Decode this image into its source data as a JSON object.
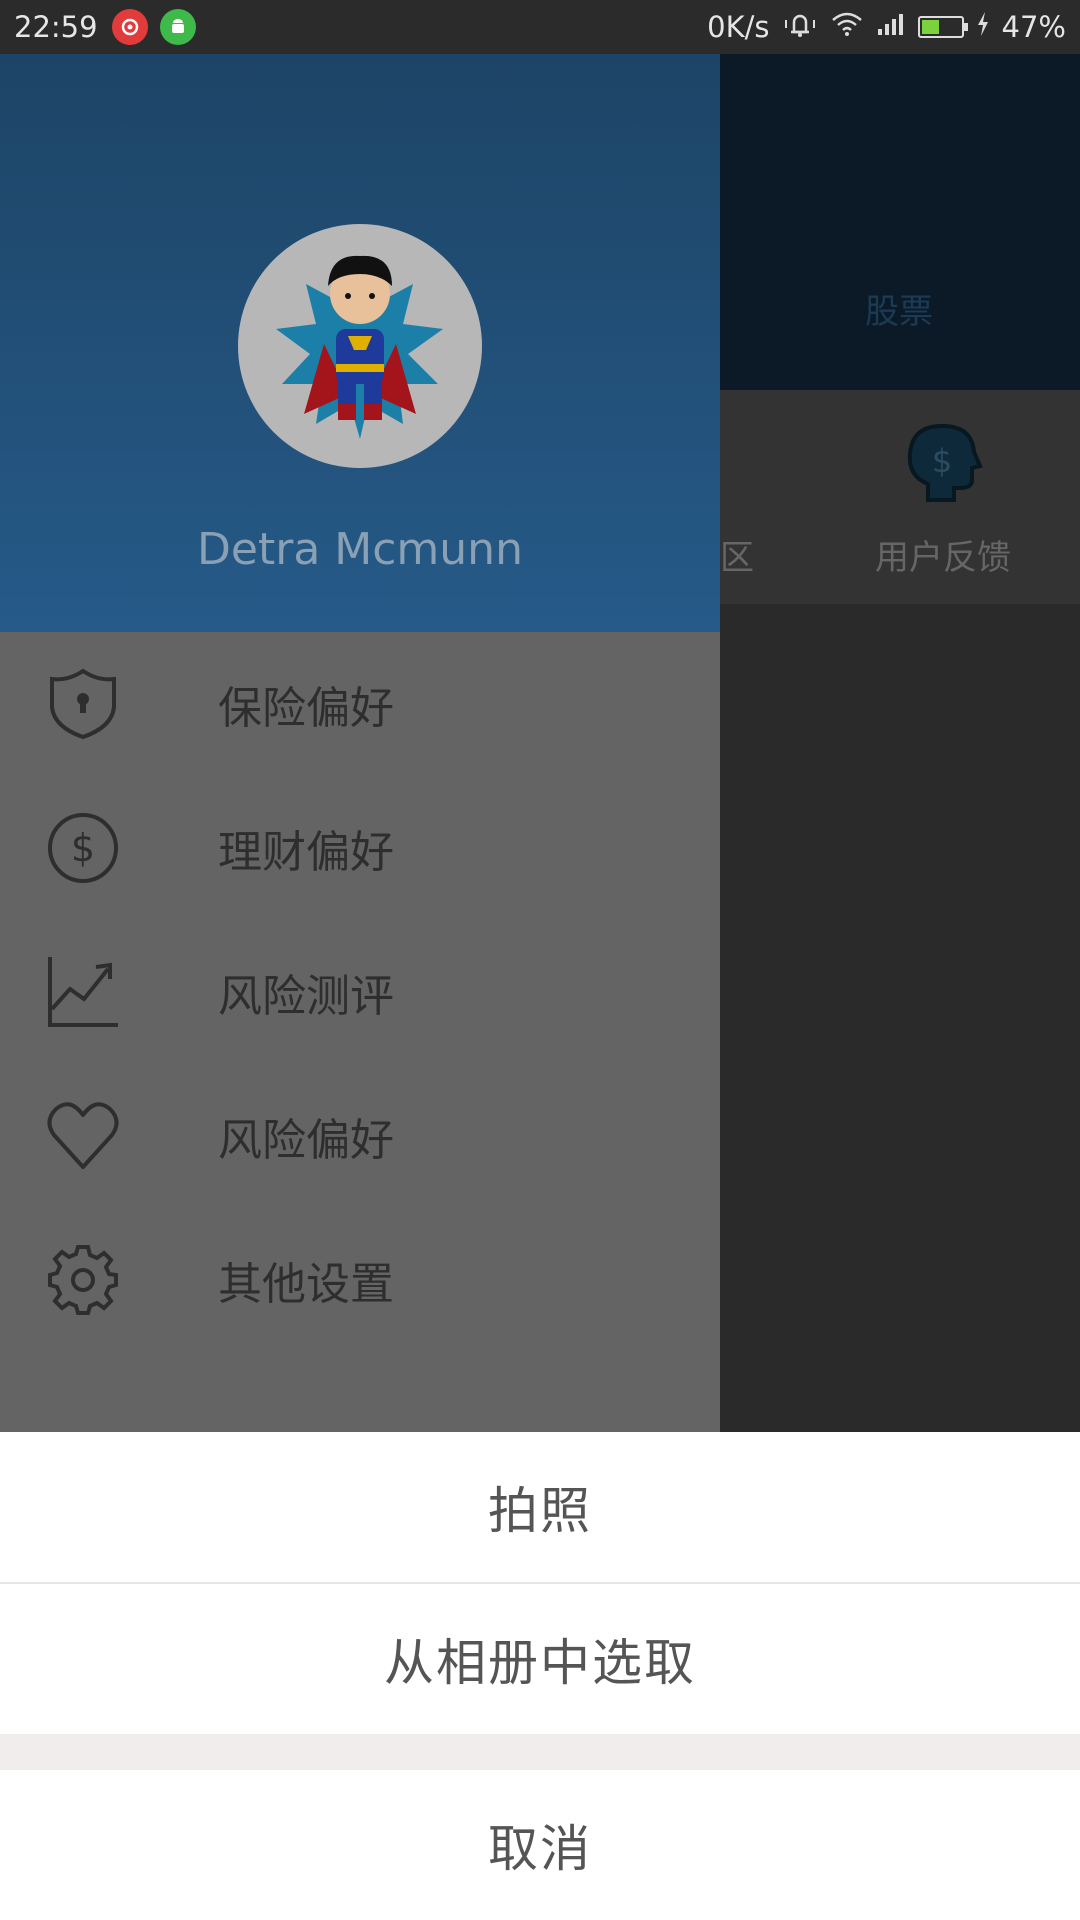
{
  "status_bar": {
    "time": "22:59",
    "net_speed": "0K/s",
    "battery_percent": "47%",
    "battery_level": 0.47,
    "icons": [
      "netease-music-icon",
      "android-app-icon",
      "mute-bell-icon",
      "wifi-icon",
      "signal-icon",
      "battery-icon",
      "charging-icon"
    ]
  },
  "background": {
    "tab_label": "股票",
    "partial_label": "区",
    "feedback_label": "用户反馈"
  },
  "drawer": {
    "username": "Detra Mcmunn",
    "items": [
      {
        "label": "保险偏好",
        "icon": "shield-lock-icon"
      },
      {
        "label": "理财偏好",
        "icon": "dollar-circle-icon"
      },
      {
        "label": "风险测评",
        "icon": "trend-chart-icon"
      },
      {
        "label": "风险偏好",
        "icon": "heart-icon"
      },
      {
        "label": "其他设置",
        "icon": "gear-icon"
      }
    ]
  },
  "sheet": {
    "take_photo": "拍照",
    "choose_album": "从相册中选取",
    "cancel": "取消"
  },
  "colors": {
    "drawer_header": "#265a88",
    "drawer_body": "#646464",
    "sheet_bg": "#ffffff"
  }
}
